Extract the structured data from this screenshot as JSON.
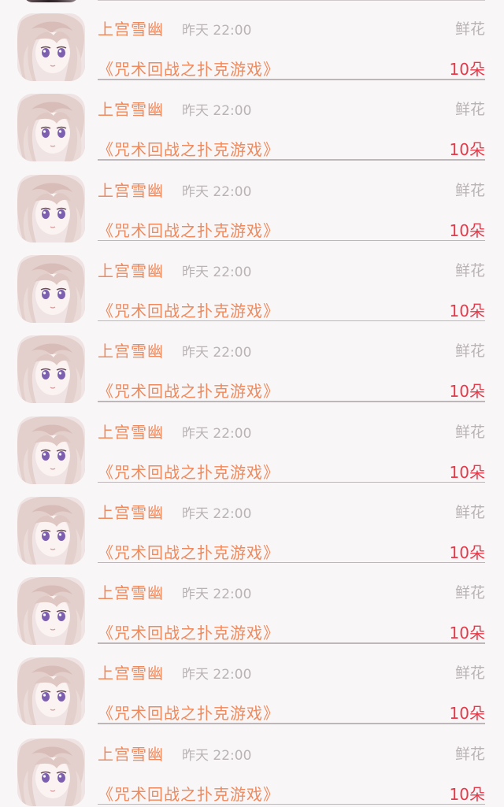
{
  "items": [
    {
      "name": "上宫雪幽",
      "time": "昨天 22:00",
      "label": "鲜花",
      "title": "《咒术回战之扑克游戏》",
      "count": "10朵"
    },
    {
      "name": "上宫雪幽",
      "time": "昨天 22:00",
      "label": "鲜花",
      "title": "《咒术回战之扑克游戏》",
      "count": "10朵"
    },
    {
      "name": "上宫雪幽",
      "time": "昨天 22:00",
      "label": "鲜花",
      "title": "《咒术回战之扑克游戏》",
      "count": "10朵"
    },
    {
      "name": "上宫雪幽",
      "time": "昨天 22:00",
      "label": "鲜花",
      "title": "《咒术回战之扑克游戏》",
      "count": "10朵"
    },
    {
      "name": "上宫雪幽",
      "time": "昨天 22:00",
      "label": "鲜花",
      "title": "《咒术回战之扑克游戏》",
      "count": "10朵"
    },
    {
      "name": "上宫雪幽",
      "time": "昨天 22:00",
      "label": "鲜花",
      "title": "《咒术回战之扑克游戏》",
      "count": "10朵"
    },
    {
      "name": "上宫雪幽",
      "time": "昨天 22:00",
      "label": "鲜花",
      "title": "《咒术回战之扑克游戏》",
      "count": "10朵"
    },
    {
      "name": "上宫雪幽",
      "time": "昨天 22:00",
      "label": "鲜花",
      "title": "《咒术回战之扑克游戏》",
      "count": "10朵"
    },
    {
      "name": "上宫雪幽",
      "time": "昨天 22:00",
      "label": "鲜花",
      "title": "《咒术回战之扑克游戏》",
      "count": "10朵"
    },
    {
      "name": "上宫雪幽",
      "time": "昨天 22:00",
      "label": "鲜花",
      "title": "《咒术回战之扑克游戏》",
      "count": "10朵"
    }
  ],
  "colors": {
    "name": "#f0895c",
    "title": "#f0895c",
    "count": "#e63a4a",
    "muted": "#b9b3b5",
    "background": "#f9f6f7"
  },
  "icons": {
    "avatar": "anime-avatar-image"
  }
}
